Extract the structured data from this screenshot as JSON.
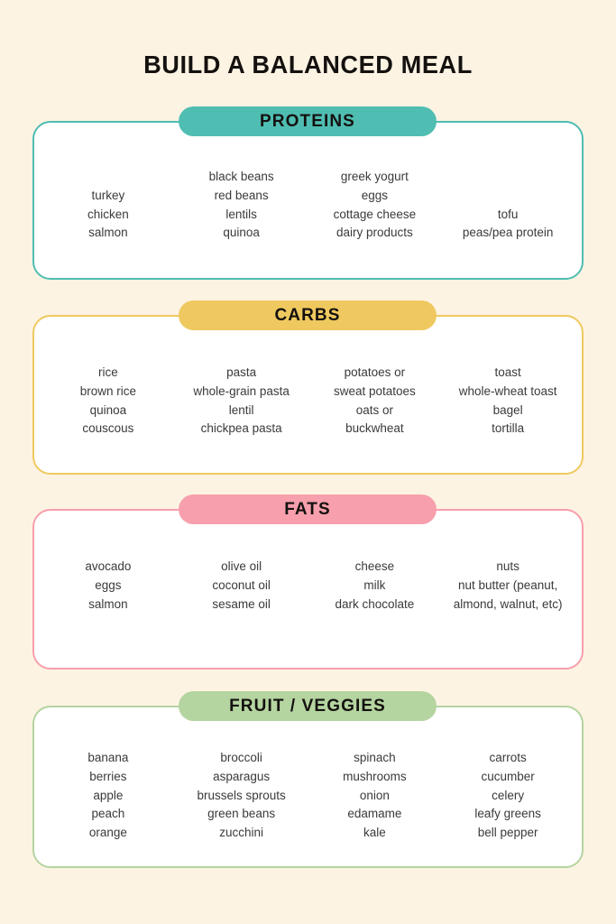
{
  "page": {
    "title": "BUILD A BALANCED MEAL",
    "background_color": "#FDF3E3",
    "text_color": "#3A3A3A",
    "title_color": "#14110F"
  },
  "sections": [
    {
      "id": "proteins",
      "label": "PROTEINS",
      "accent_color": "#4FBDB2",
      "columns": [
        {
          "items": [
            "turkey",
            "chicken",
            "salmon"
          ]
        },
        {
          "items": [
            "black beans",
            "red beans",
            "lentils",
            "quinoa"
          ]
        },
        {
          "items": [
            "greek yogurt",
            "eggs",
            "cottage cheese",
            "dairy products"
          ]
        },
        {
          "items": [
            "tofu",
            "peas/pea protein"
          ]
        }
      ]
    },
    {
      "id": "carbs",
      "label": "CARBS",
      "accent_color": "#EFC95F",
      "columns": [
        {
          "items": [
            "rice",
            "brown rice",
            "quinoa",
            "couscous"
          ]
        },
        {
          "items": [
            "pasta",
            "whole-grain pasta",
            "lentil",
            "chickpea pasta"
          ]
        },
        {
          "items": [
            "potatoes or",
            "sweat potatoes",
            "oats or",
            "buckwheat"
          ]
        },
        {
          "items": [
            "toast",
            "whole-wheat toast",
            "bagel",
            "tortilla"
          ]
        }
      ]
    },
    {
      "id": "fats",
      "label": "FATS",
      "accent_color": "#F79FAC",
      "columns": [
        {
          "items": [
            "avocado",
            "eggs",
            "salmon"
          ]
        },
        {
          "items": [
            "olive oil",
            "coconut oil",
            "sesame oil"
          ]
        },
        {
          "items": [
            "cheese",
            "milk",
            "dark chocolate"
          ]
        },
        {
          "items": [
            "nuts",
            "nut butter (peanut,",
            "almond, walnut, etc)"
          ]
        }
      ]
    },
    {
      "id": "fruit-veggies",
      "label": "FRUIT / VEGGIES",
      "accent_color": "#B4D4A0",
      "columns": [
        {
          "items": [
            "banana",
            "berries",
            "apple",
            "peach",
            "orange"
          ]
        },
        {
          "items": [
            "broccoli",
            "asparagus",
            "brussels sprouts",
            "green beans",
            "zucchini"
          ]
        },
        {
          "items": [
            "spinach",
            "mushrooms",
            "onion",
            "edamame",
            "kale"
          ]
        },
        {
          "items": [
            "carrots",
            "cucumber",
            "celery",
            "leafy greens",
            "bell pepper"
          ]
        }
      ]
    }
  ]
}
